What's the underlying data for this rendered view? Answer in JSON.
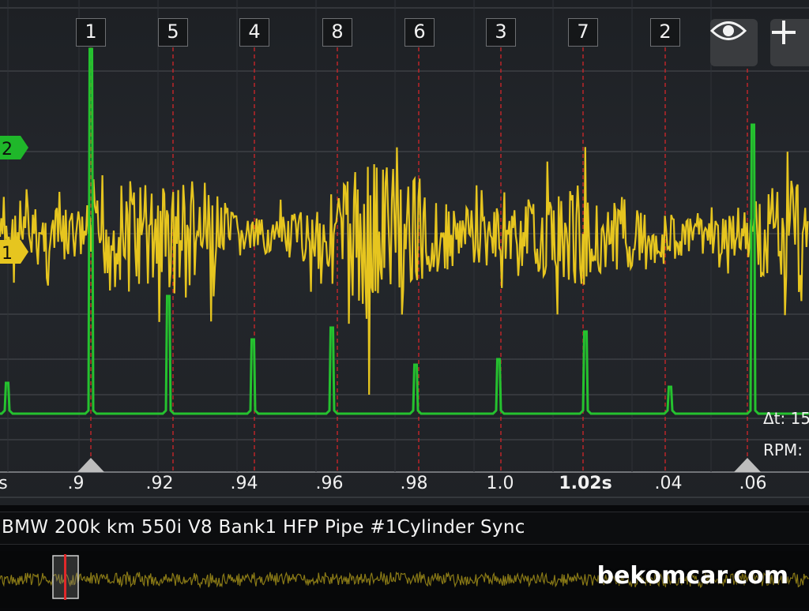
{
  "cylinder_markers": [
    "1",
    "5",
    "4",
    "8",
    "6",
    "3",
    "7",
    "2"
  ],
  "channels": {
    "ch1_label": "1",
    "ch2_label": "2"
  },
  "time_axis": {
    "ticks": [
      "s",
      ".9",
      ".92",
      ".94",
      ".96",
      ".98",
      "1.0",
      "1.02s",
      ".04",
      ".06"
    ],
    "bold_tick": "1.02s"
  },
  "readouts": {
    "delta_t": "Δt: 15",
    "rpm": "RPM:"
  },
  "toolbar": {
    "eye_icon": "eye-icon",
    "add_icon": "plus-icon"
  },
  "recording_title": "BMW 200k km 550i V8 Bank1 HFP Pipe #1Cylinder Sync",
  "watermark": "bekomcar.com",
  "colors": {
    "channel_yellow": "#e6c51f",
    "channel_green": "#25c22f",
    "marker_red": "#e0282a",
    "background": "#202327"
  }
}
